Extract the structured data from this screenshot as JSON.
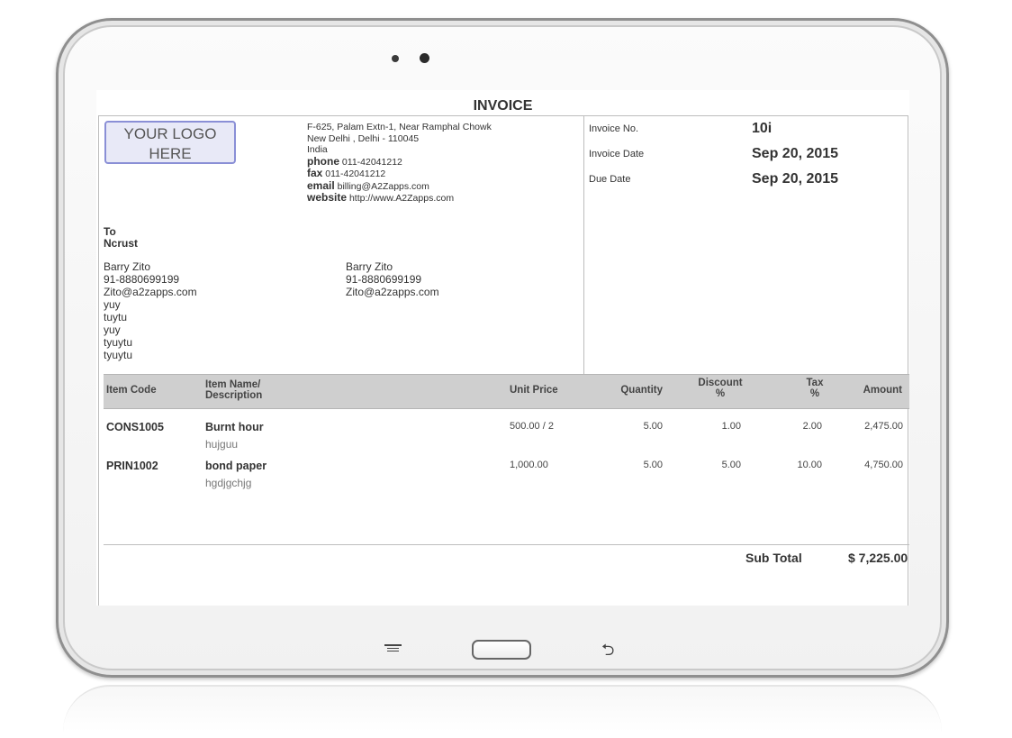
{
  "invoice": {
    "title": "INVOICE",
    "logo_text_line1": "YOUR LOGO",
    "logo_text_line2": "HERE",
    "company": {
      "address_line1": "F-625, Palam Extn-1, Near Ramphal Chowk",
      "address_line2": "New Delhi , Delhi - 110045",
      "country": "India",
      "phone_label": "phone",
      "phone": "011-42041212",
      "fax_label": "fax",
      "fax": "011-42041212",
      "email_label": "email",
      "email": "billing@A2Zapps.com",
      "website_label": "website",
      "website": "http://www.A2Zapps.com"
    },
    "meta": {
      "invoice_no_label": "Invoice No.",
      "invoice_no": "10i",
      "invoice_date_label": "Invoice Date",
      "invoice_date": "Sep 20, 2015",
      "due_date_label": "Due Date",
      "due_date": "Sep 20, 2015"
    },
    "to": {
      "label": "To",
      "company": "Ncrust",
      "billing": [
        "Barry Zito",
        "91-8880699199",
        "Zito@a2zapps.com",
        "yuy",
        "tuytu",
        "yuy",
        "tyuytu",
        "tyuytu"
      ],
      "shipping": [
        "Barry Zito",
        "91-8880699199",
        "Zito@a2zapps.com"
      ]
    },
    "table": {
      "headers": {
        "item_code": "Item Code",
        "item_name_l1": "Item Name/",
        "item_name_l2": "Description",
        "unit_price": "Unit Price",
        "quantity": "Quantity",
        "discount_l1": "Discount",
        "discount_l2": "%",
        "tax_l1": "Tax",
        "tax_l2": "%",
        "amount": "Amount"
      },
      "rows": [
        {
          "code": "CONS1005",
          "name": "Burnt hour",
          "description": "hujguu",
          "unit_price": "500.00 / 2",
          "quantity": "5.00",
          "discount": "1.00",
          "tax": "2.00",
          "amount": "2,475.00"
        },
        {
          "code": "PRIN1002",
          "name": "bond paper",
          "description": "hgdjgchjg",
          "unit_price": "1,000.00",
          "quantity": "5.00",
          "discount": "5.00",
          "tax": "10.00",
          "amount": "4,750.00"
        }
      ]
    },
    "subtotal_label": "Sub Total",
    "subtotal_value": "$ 7,225.00"
  },
  "device": {
    "nav_icons": [
      "menu-icon",
      "home-button",
      "back-icon"
    ],
    "back_glyph": "⮌"
  }
}
